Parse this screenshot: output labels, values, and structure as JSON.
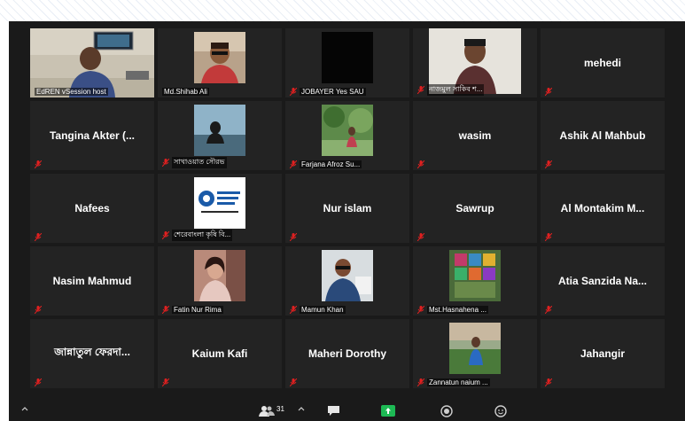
{
  "host_tile": {
    "name": "EdREN vSession host"
  },
  "tiles": [
    {
      "name": "Md.Shihab Ali",
      "kind": "photo"
    },
    {
      "name": "JOBAYER Yes SAU",
      "kind": "photo-dark"
    },
    {
      "name": "নাজমুল সাকিব শ...",
      "kind": "photo"
    },
    {
      "name": "mehedi",
      "kind": "text"
    },
    {
      "name": "Tangina Akter (...",
      "kind": "text"
    },
    {
      "name": "সাখাওয়াত সৌরভ",
      "kind": "photo"
    },
    {
      "name": "Farjana Afroz Su...",
      "kind": "photo"
    },
    {
      "name": "wasim",
      "kind": "text"
    },
    {
      "name": "Ashik Al Mahbub",
      "kind": "text"
    },
    {
      "name": "Nafees",
      "kind": "text"
    },
    {
      "name": "শেরেবাংলা কৃষি বি...",
      "kind": "photo"
    },
    {
      "name": "Nur islam",
      "kind": "text"
    },
    {
      "name": "Sawrup",
      "kind": "text"
    },
    {
      "name": "Al Montakim M...",
      "kind": "text"
    },
    {
      "name": "Nasim Mahmud",
      "kind": "text"
    },
    {
      "name": "Fatin Nur Rima",
      "kind": "photo"
    },
    {
      "name": "Mamun Khan",
      "kind": "photo"
    },
    {
      "name": "Mst.Hasnahena ...",
      "kind": "photo"
    },
    {
      "name": "Atia Sanzida Na...",
      "kind": "text"
    },
    {
      "name": "জান্নাতুল ফেরদা...",
      "kind": "text"
    },
    {
      "name": "Kaium Kafi",
      "kind": "text"
    },
    {
      "name": "Maheri Dorothy",
      "kind": "text"
    },
    {
      "name": "Zannatun naium ...",
      "kind": "photo"
    },
    {
      "name": "Jahangir",
      "kind": "text"
    }
  ],
  "toolbar": {
    "participants_count": "31"
  },
  "icons": {
    "mute": "muted-mic-icon",
    "participants": "participants-icon",
    "chat": "chat-icon",
    "share": "share-screen-icon",
    "record": "record-icon",
    "reactions": "reactions-icon"
  },
  "colors": {
    "active_speaker": "#c6d72a",
    "muted_mic": "#e02020",
    "share_button": "#1db954"
  }
}
